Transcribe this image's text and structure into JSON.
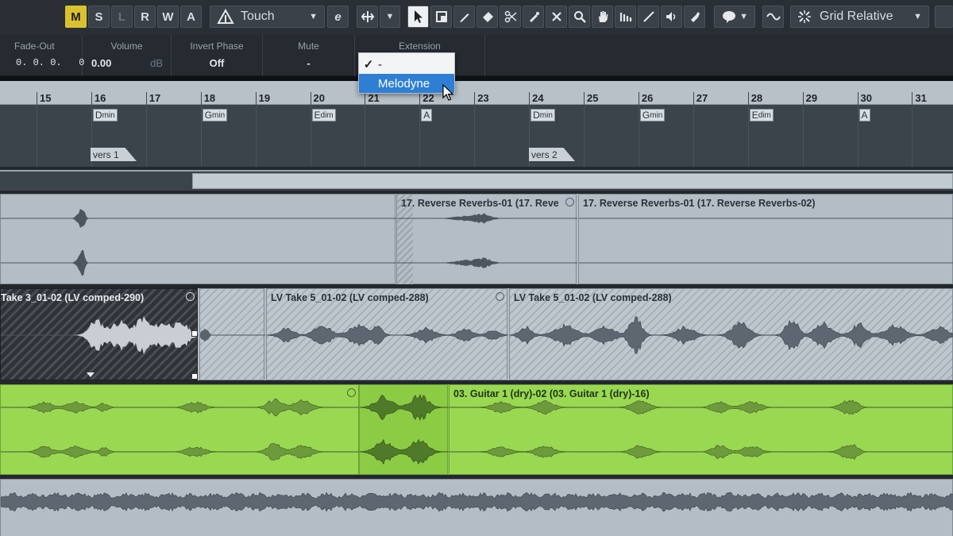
{
  "toolbar": {
    "buttons": [
      {
        "label": "M",
        "state": "active"
      },
      {
        "label": "S",
        "state": "normal"
      },
      {
        "label": "L",
        "state": "dim"
      },
      {
        "label": "R",
        "state": "normal"
      },
      {
        "label": "W",
        "state": "normal"
      },
      {
        "label": "A",
        "state": "normal"
      }
    ],
    "automation_mode": "Touch",
    "snap_mode": "Grid Relative",
    "icons": [
      "automation-icon",
      "expression-icon",
      "transport-move-icon",
      "object-selection-icon",
      "range-selection-icon",
      "draw-icon",
      "erase-icon",
      "split-icon",
      "glue-icon",
      "mute-tool-icon",
      "zoom-icon",
      "hand-icon",
      "comp-icon",
      "line-icon",
      "play-icon",
      "color-icon",
      "quantize-icon",
      "snap-icon"
    ]
  },
  "infoline": {
    "fade_out": {
      "label": "Fade-Out",
      "value": "0. 0. 0.   0"
    },
    "volume": {
      "label": "Volume",
      "value": "0.00",
      "unit": "dB"
    },
    "invert_phase": {
      "label": "Invert Phase",
      "value": "Off"
    },
    "mute": {
      "label": "Mute",
      "value": "-"
    },
    "extension": {
      "label": "Extension"
    }
  },
  "extension_menu": {
    "items": [
      {
        "label": "-",
        "checked": true
      },
      {
        "label": "Melodyne",
        "highlighted": true
      }
    ]
  },
  "ruler": {
    "bars": [
      "15",
      "16",
      "17",
      "18",
      "19",
      "20",
      "21",
      "22",
      "23",
      "24",
      "25",
      "26",
      "27",
      "28",
      "29",
      "30",
      "31"
    ]
  },
  "chords": [
    {
      "root": "D",
      "quality": "min"
    },
    {
      "root": "G",
      "quality": "min"
    },
    {
      "root": "E",
      "quality": "dim"
    },
    {
      "root": "A",
      "quality": ""
    },
    {
      "root": "D",
      "quality": "min"
    },
    {
      "root": "G",
      "quality": "min"
    },
    {
      "root": "E",
      "quality": "dim"
    },
    {
      "root": "A",
      "quality": ""
    }
  ],
  "markers": [
    "vers 1",
    "vers 2"
  ],
  "events": {
    "reverb_a": "17. Reverse Reverbs-01 (17. Reve",
    "reverb_b": "17. Reverse Reverbs-01 (17. Reverse Reverbs-02)",
    "take3": "Take 3_01-02 (LV comped-290)",
    "take5a": "LV Take 5_01-02 (LV comped-288)",
    "take5b": "LV Take 5_01-02 (LV comped-288)",
    "guitar": "03. Guitar 1 (dry)-02 (03. Guitar 1 (dry)-16)"
  },
  "colors": {
    "toolbar_bg": "#2a2f35",
    "mute_active": "#d9c230",
    "guitar_event": "#9ad852",
    "menu_highlight": "#2e7fd4"
  }
}
